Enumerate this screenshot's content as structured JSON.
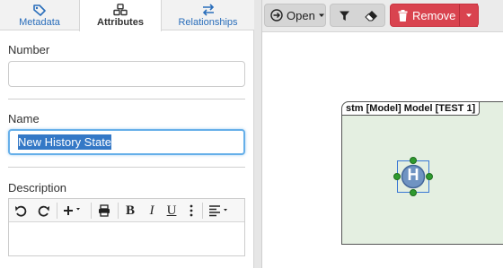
{
  "left_panel": {
    "tabs": [
      {
        "label": "Metadata",
        "icon": "tag-icon"
      },
      {
        "label": "Attributes",
        "icon": "cubes-icon"
      },
      {
        "label": "Relationships",
        "icon": "swap-arrows-icon"
      }
    ],
    "active_tab": "Attributes",
    "fields": {
      "number": {
        "label": "Number",
        "value": ""
      },
      "name": {
        "label": "Name",
        "value": "New History State"
      },
      "description": {
        "label": "Description",
        "value": ""
      }
    },
    "editor_toolbar": [
      "undo-icon",
      "redo-icon",
      "plus-dropdown-icon",
      "print-icon",
      "bold-icon",
      "italic-icon",
      "underline-icon",
      "more-vertical-icon",
      "align-dropdown-icon"
    ]
  },
  "right_panel": {
    "toolbar": {
      "open_label": "Open",
      "remove_label": "Remove"
    },
    "diagram": {
      "title": "stm [Model] Model [TEST 1]",
      "node_label": "H"
    },
    "colors": {
      "accent": "#2a6ebb",
      "remove_button": "#d9434f",
      "state_machine_fill": "#e4efe1",
      "history_node": "#6f93c2",
      "selection_handle": "#2e9a2e"
    }
  }
}
